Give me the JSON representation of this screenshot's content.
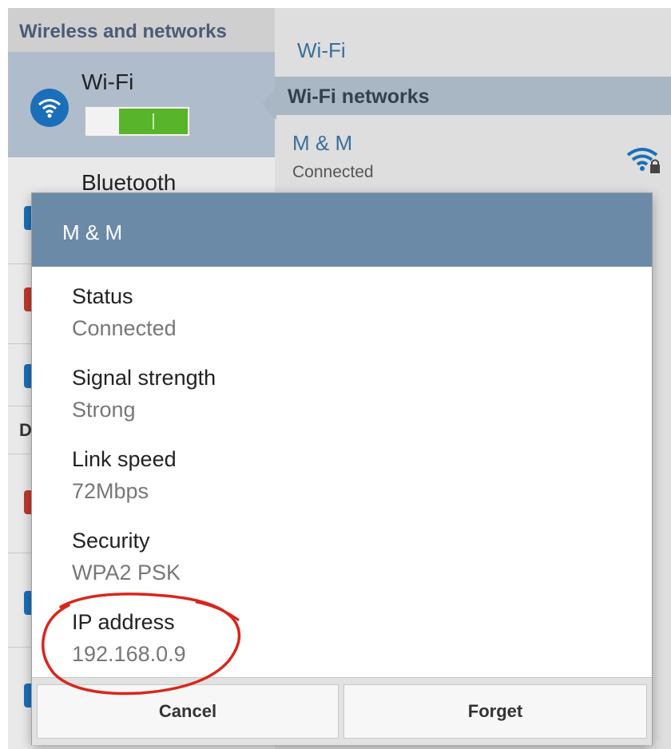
{
  "left_panel": {
    "section_title": "Wireless and networks",
    "wifi_label": "Wi-Fi",
    "wifi_toggle_on": true,
    "bluetooth_label": "Bluetooth",
    "partial_section_letter": "D"
  },
  "right_panel": {
    "title": "Wi-Fi",
    "networks_header": "Wi-Fi networks",
    "network": {
      "name": "M & M",
      "status": "Connected"
    }
  },
  "dialog": {
    "title": "M & M",
    "details": [
      {
        "label": "Status",
        "value": "Connected"
      },
      {
        "label": "Signal strength",
        "value": "Strong"
      },
      {
        "label": "Link speed",
        "value": "72Mbps"
      },
      {
        "label": "Security",
        "value": "WPA2 PSK"
      },
      {
        "label": "IP address",
        "value": "192.168.0.9"
      }
    ],
    "cancel_label": "Cancel",
    "forget_label": "Forget"
  },
  "colors": {
    "accent": "#3a6f9c",
    "dialog_header": "#6b8aa8",
    "toggle_on": "#58b42a",
    "annotation": "#d9261c"
  },
  "icons": {
    "wifi": "wifi-icon",
    "secure_signal": "wifi-lock-icon"
  }
}
